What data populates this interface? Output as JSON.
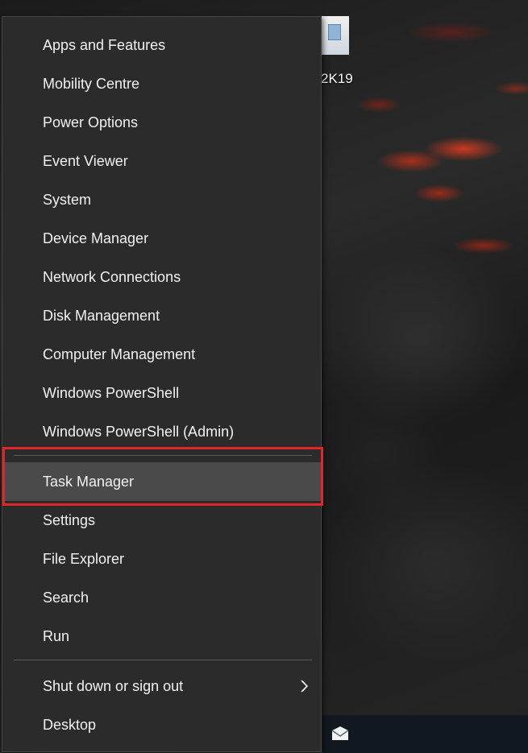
{
  "desktop": {
    "label": "2K19"
  },
  "menu": {
    "items_group1": [
      {
        "label": "Apps and Features"
      },
      {
        "label": "Mobility Centre"
      },
      {
        "label": "Power Options"
      },
      {
        "label": "Event Viewer"
      },
      {
        "label": "System"
      },
      {
        "label": "Device Manager"
      },
      {
        "label": "Network Connections"
      },
      {
        "label": "Disk Management"
      },
      {
        "label": "Computer Management"
      },
      {
        "label": "Windows PowerShell"
      },
      {
        "label": "Windows PowerShell (Admin)"
      }
    ],
    "items_group2": [
      {
        "label": "Task Manager"
      },
      {
        "label": "Settings"
      },
      {
        "label": "File Explorer"
      },
      {
        "label": "Search"
      },
      {
        "label": "Run"
      }
    ],
    "items_group3": [
      {
        "label": "Shut down or sign out",
        "submenu_icon": "chevron-right-icon"
      },
      {
        "label": "Desktop"
      }
    ],
    "highlighted_item": "Task Manager",
    "highlight_color": "#e0262b"
  },
  "taskbar": {
    "icons": [
      "mail-icon"
    ]
  }
}
